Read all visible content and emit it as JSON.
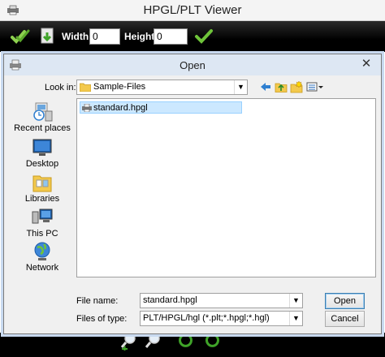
{
  "app": {
    "title": "HPGL/PLT Viewer",
    "toolbar": {
      "width_label": "Width",
      "width_value": "0",
      "height_label": "Height",
      "height_value": "0"
    }
  },
  "dialog": {
    "title": "Open",
    "close_glyph": "✕",
    "look_in_label": "Look in:",
    "look_in_value": "Sample-Files",
    "places": [
      {
        "label": "Recent places"
      },
      {
        "label": "Desktop"
      },
      {
        "label": "Libraries"
      },
      {
        "label": "This PC"
      },
      {
        "label": "Network"
      }
    ],
    "files": [
      {
        "name": "standard.hpgl",
        "selected": true
      }
    ],
    "file_name_label": "File name:",
    "file_name_value": "standard.hpgl",
    "file_type_label": "Files of type:",
    "file_type_value": "PLT/HPGL/hgl (*.plt;*.hpgl;*.hgl)",
    "open_label": "Open",
    "cancel_label": "Cancel"
  },
  "colors": {
    "toolbar_bg": "#000000",
    "check_green": "#6fc43a",
    "dialog_title_bg": "#dde7f3",
    "selection_bg": "#cce8ff"
  },
  "icons": {
    "toolbar": [
      "check-double-icon",
      "download-icon",
      "apply-check-icon"
    ],
    "nav": [
      "back-arrow-icon",
      "up-folder-icon",
      "new-folder-icon",
      "view-menu-icon"
    ],
    "bottom": [
      "zoom-in-icon",
      "zoom-out-icon",
      "rotate-left-icon",
      "rotate-right-icon"
    ]
  }
}
